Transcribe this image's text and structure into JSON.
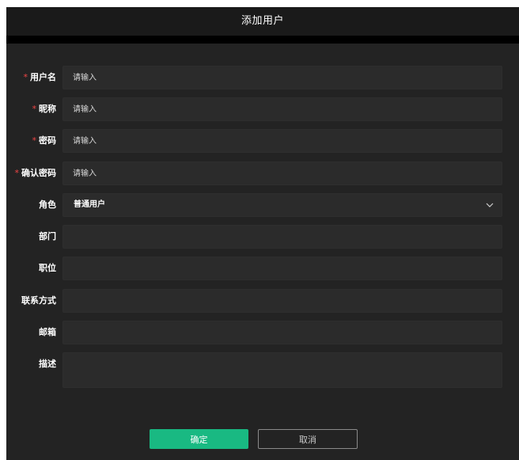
{
  "dialog": {
    "title": "添加用户"
  },
  "form": {
    "username": {
      "label": "用户名",
      "required_mark": "*",
      "placeholder": "请输入",
      "value": ""
    },
    "nickname": {
      "label": "昵称",
      "required_mark": "*",
      "placeholder": "请输入",
      "value": ""
    },
    "password": {
      "label": "密码",
      "required_mark": "*",
      "placeholder": "请输入",
      "value": ""
    },
    "confirm_password": {
      "label": "确认密码",
      "required_mark": "*",
      "placeholder": "请输入",
      "value": ""
    },
    "role": {
      "label": "角色",
      "selected": "普通用户",
      "icon": "chevron-down-icon"
    },
    "department": {
      "label": "部门",
      "value": ""
    },
    "position": {
      "label": "职位",
      "value": ""
    },
    "contact": {
      "label": "联系方式",
      "value": ""
    },
    "email": {
      "label": "邮箱",
      "value": ""
    },
    "description": {
      "label": "描述",
      "value": ""
    }
  },
  "buttons": {
    "confirm": "确定",
    "cancel": "取消"
  },
  "colors": {
    "dialog_bg": "#232323",
    "header_bg": "#1a1a1a",
    "input_bg": "#2b2b2b",
    "required": "#f04545",
    "primary": "#19b982"
  }
}
